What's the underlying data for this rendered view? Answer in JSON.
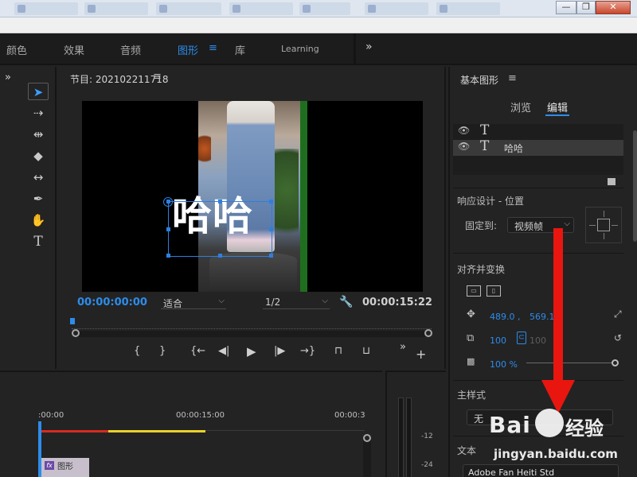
{
  "window_controls": {
    "minimize": "—",
    "restore": "❐",
    "close": "✕"
  },
  "workspaces": {
    "tabs": [
      {
        "label": "颜色"
      },
      {
        "label": "效果"
      },
      {
        "label": "音频"
      },
      {
        "label": "图形"
      },
      {
        "label": "库"
      },
      {
        "label": "Learning"
      }
    ],
    "active": "图形",
    "menu_glyph": "≡",
    "more_glyph": "»"
  },
  "left_panel": {
    "more_glyph": "»"
  },
  "tools": {
    "select": "➤",
    "track_select": "⇢",
    "ripple": "⇹",
    "razor": "◆",
    "slip": "↔",
    "pen": "✒",
    "hand": "✋",
    "type": "T"
  },
  "program": {
    "title": "节目: 202102211718",
    "menu_glyph": "≡",
    "overlay_text": "哈哈",
    "timecode_current": "00:00:00:00",
    "fit_label": "适合",
    "resolution_label": "1/2",
    "timecode_duration": "00:00:15:22",
    "controls": {
      "mark_in": "{",
      "mark_out": "}",
      "go_in": "{←",
      "step_back": "◀|",
      "play": "▶",
      "step_forward": "|▶",
      "go_out": "→}",
      "lift": "⊓",
      "extract": "⊔",
      "more": "»",
      "add": "+"
    }
  },
  "essential_graphics": {
    "title": "基本图形",
    "menu_glyph": "≡",
    "tabs": {
      "browse": "浏览",
      "edit": "编辑"
    },
    "active_tab": "编辑",
    "layers": [
      {
        "name": "",
        "selected": false
      },
      {
        "name": "哈哈",
        "selected": true
      }
    ],
    "responsive_label": "响应设计 - 位置",
    "pin_label": "固定到:",
    "pin_value": "视频帧",
    "align_label": "对齐并变换",
    "position_x": "489.0 ,",
    "position_y": "569.1",
    "scale": "100",
    "scale_linked": "100",
    "opacity": "100 %",
    "opacity_fraction": 1.0,
    "master_style_label": "主样式",
    "master_style_value": "无",
    "text_label": "文本",
    "font_value": "Adobe Fan Heiti Std"
  },
  "timeline": {
    "times": [
      ":00:00",
      "00:00:15:00",
      "00:00:3"
    ],
    "clip_name": "图形",
    "clip_fx": "fx"
  },
  "meter": {
    "db_labels": [
      "-12",
      "-24"
    ]
  },
  "watermark": {
    "logo": "Bai",
    "product": "经验",
    "url": "jingyan.baidu.com"
  },
  "colors": {
    "accent": "#2d8ceb",
    "annotation": "#e8160f"
  }
}
